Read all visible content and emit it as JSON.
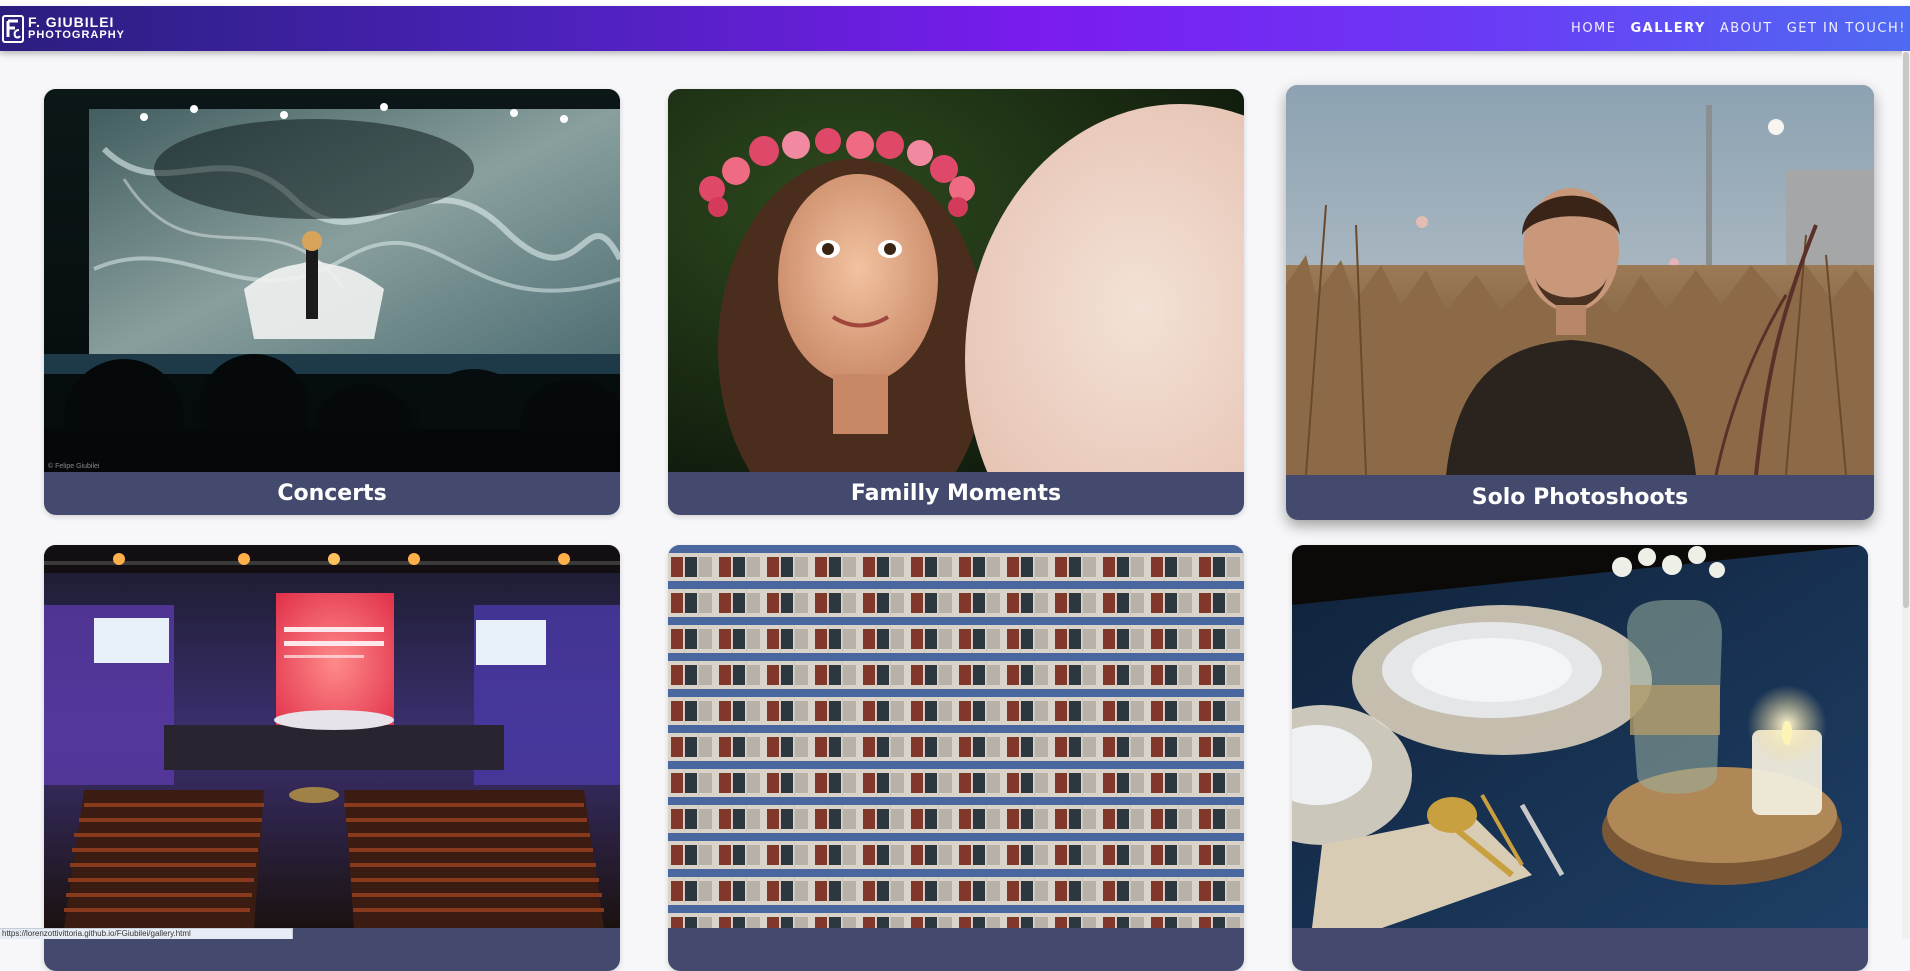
{
  "brand": {
    "line1": "F. GIUBILEI",
    "line2": "PHOTOGRAPHY",
    "logo_icon": "fg-monogram-icon"
  },
  "nav": {
    "items": [
      {
        "label": "HOME",
        "active": false
      },
      {
        "label": "GALLERY",
        "active": true
      },
      {
        "label": "ABOUT",
        "active": false
      },
      {
        "label": "GET IN TOUCH!",
        "active": false
      }
    ]
  },
  "gallery": {
    "cards": [
      {
        "caption": "Concerts",
        "image": "concert-stage-performer-photo",
        "watermark": "© Felipe Giubilei"
      },
      {
        "caption": "Familly Moments",
        "image": "girl-flower-crown-pregnant-belly-photo"
      },
      {
        "caption": "Solo Photoshoots",
        "image": "man-in-tall-grass-photo"
      },
      {
        "caption": "",
        "image": "event-auditorium-stage-photo"
      },
      {
        "caption": "",
        "image": "apartment-building-facade-photo"
      },
      {
        "caption": "",
        "image": "table-setting-candle-photo"
      }
    ]
  },
  "status": {
    "url": "https://lorenzottivittoria.github.io/FGiubilei/gallery.html"
  },
  "colors": {
    "caption_bar": "#444a6e",
    "navbar_gradient_start": "#2a1e7e",
    "navbar_gradient_mid": "#7a1cf0",
    "navbar_gradient_end": "#4f6af2"
  }
}
